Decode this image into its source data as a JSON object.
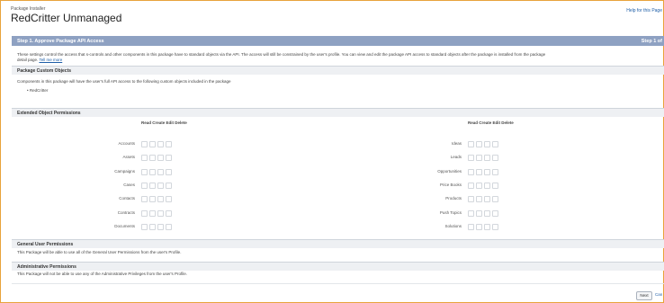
{
  "header": {
    "eyebrow": "Package Installer",
    "title": "RedCritter Unmanaged",
    "help_link": "Help for this Page"
  },
  "step_bar": {
    "title": "Step 1. Approve Package API Access",
    "step_label": "Step 1 of"
  },
  "intro": {
    "line1": "These settings control the access that s-controls and other components in this package have to standard objects via the API. The access will still be constrained by the user's profile. You can view and edit the package API access to standard objects after the package is installed from the package",
    "line2": "detail page.",
    "tell_more": "Tell me more"
  },
  "custom_objects": {
    "heading": "Package Custom Objects",
    "text": "Components in this package will have the user's full API access to the following custom objects included in the package",
    "items": [
      "RedCritter"
    ]
  },
  "extended": {
    "heading": "Extended Object Permissions",
    "col_header": "Read Create Edit Delete",
    "left": [
      "Accounts",
      "Assets",
      "Campaigns",
      "Cases",
      "Contacts",
      "Contracts",
      "Documents"
    ],
    "right": [
      "Ideas",
      "Leads",
      "Opportunities",
      "Price Books",
      "Products",
      "Push Topics",
      "Solutions"
    ]
  },
  "general": {
    "heading": "General User Permissions",
    "text": "This Package will be able to use all of the General User Permissions from the user's Profile."
  },
  "admin": {
    "heading": "Administrative Permissions",
    "text": "This Package will not be able to use any of the Administrative Privileges from the user's Profile."
  },
  "footer": {
    "next_label": "Next",
    "cancel_label": "Can"
  }
}
